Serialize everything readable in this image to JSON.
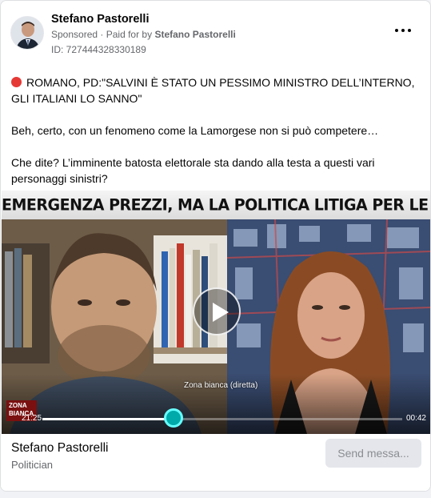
{
  "post": {
    "author": "Stefano Pastorelli",
    "sponsored_label": "Sponsored",
    "paid_for_prefix": "Paid for by",
    "paid_for_by": "Stefano Pastorelli",
    "ad_id": "ID: 727444328330189",
    "headline": "ROMANO, PD:\"SALVINI È STATO UN PESSIMO MINISTRO DELL’INTERNO, GLI ITALIANI LO SANNO\"",
    "paragraph_2": "Beh, certo, con un fenomeno come la Lamorgese non si può competere…",
    "paragraph_3": "Che dite? L’imminente batosta elettorale sta dando alla testa a questi vari personaggi sinistri?"
  },
  "video": {
    "banner_text": "EMERGENZA PREZZI, MA LA POLITICA LITIGA PER LE POLTRONE",
    "caption": "Zona bianca (diretta)",
    "time_current": "21:25",
    "time_end": "00:42",
    "progress_fraction": 0.36,
    "broadcaster_logo": "ZONA BIANCA"
  },
  "footer": {
    "page_name": "Stefano Pastorelli",
    "category": "Politician",
    "cta_label": "Send messa..."
  },
  "colors": {
    "red_dot": "#e53935",
    "text_secondary": "#65676b",
    "button_bg": "#e4e6eb"
  },
  "icons": [
    "more-options-icon",
    "play-icon",
    "red-circle-icon"
  ]
}
